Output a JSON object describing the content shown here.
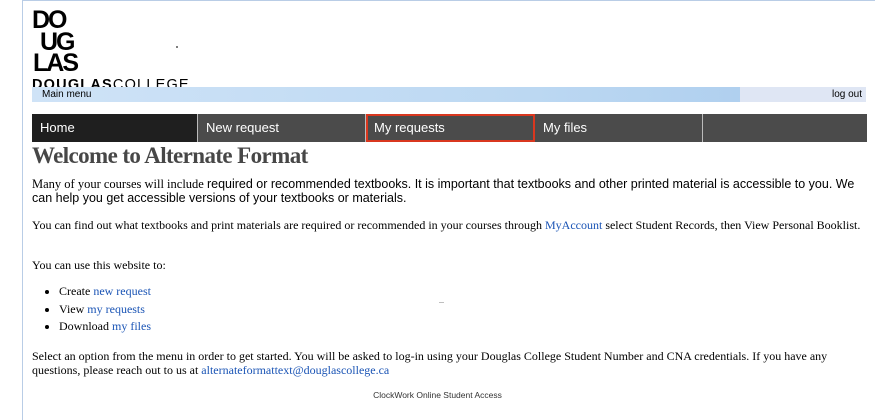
{
  "brand": {
    "logo_wordmark_bold": "DOUGLAS",
    "logo_wordmark_light": "COLLEGE",
    "logo_mark_letters": [
      "DO",
      "UG",
      "LAS"
    ]
  },
  "menu_bar": {
    "title": "Main menu",
    "logout_label": "log out"
  },
  "nav": {
    "items": [
      {
        "label": "Home"
      },
      {
        "label": "New request"
      },
      {
        "label": "My requests"
      },
      {
        "label": "My files"
      },
      {
        "label": ""
      }
    ]
  },
  "content": {
    "heading": "Welcome to Alternate Format",
    "intro_serif": "Many of your courses will include ",
    "intro_sans": "required or recommended textbooks. It is important that textbooks and other printed material is accessible to you. We can help you get accessible versions of your textbooks or materials.",
    "booklist_pre": "You can find out what textbooks and print materials are required or recommended in your courses through ",
    "booklist_link": "MyAccount",
    "booklist_post": " select Student Records, then View Personal Booklist.",
    "uses_intro": "You can use this website to:",
    "uses": [
      {
        "verb": "Create",
        "link": "new request"
      },
      {
        "verb": "View",
        "link": "my requests"
      },
      {
        "verb": "Download",
        "link": "my files"
      }
    ],
    "closing_pre": "Select an option from the menu in order to get started. You will be asked to log-in using your Douglas College Student Number and CNA credentials. If you have any questions, please reach out to us at ",
    "closing_email": "alternateformattext@douglascollege.ca"
  },
  "footer": {
    "text": "ClockWork Online Student Access"
  }
}
